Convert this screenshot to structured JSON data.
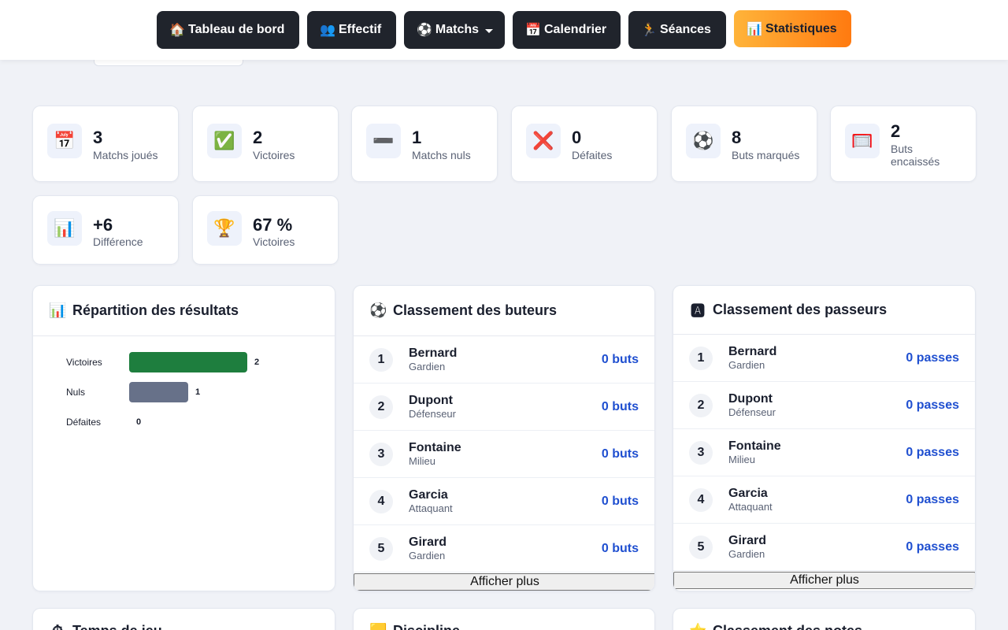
{
  "nav": {
    "items": [
      {
        "icon": "🏠",
        "label": "Tableau de bord"
      },
      {
        "icon": "👥",
        "label": "Effectif"
      },
      {
        "icon": "⚽",
        "label": "Matchs"
      },
      {
        "icon": "📅",
        "label": "Calendrier"
      },
      {
        "icon": "🏃",
        "label": "Séances"
      },
      {
        "icon": "📊",
        "label": "Statistiques"
      }
    ]
  },
  "stats": [
    {
      "icon": "📅",
      "value": "3",
      "label": "Matchs joués"
    },
    {
      "icon": "✅",
      "value": "2",
      "label": "Victoires"
    },
    {
      "icon": "➖",
      "value": "1",
      "label": "Matchs nuls"
    },
    {
      "icon": "❌",
      "value": "0",
      "label": "Défaites"
    },
    {
      "icon": "⚽",
      "value": "8",
      "label": "Buts marqués"
    },
    {
      "icon": "🥅",
      "value": "2",
      "label": "Buts encaissés"
    },
    {
      "icon": "📊",
      "value": "+6",
      "label": "Différence"
    },
    {
      "icon": "🏆",
      "value": "67 %",
      "label": "Victoires"
    }
  ],
  "results": {
    "icon": "📊",
    "title": "Répartition des résultats",
    "rows": [
      {
        "label": "Victoires",
        "value": 2,
        "color": "#1e7e3e"
      },
      {
        "label": "Nuls",
        "value": 1,
        "color": "#677189"
      },
      {
        "label": "Défaites",
        "value": 0,
        "color": "#c0392b"
      }
    ]
  },
  "scorers": {
    "icon": "⚽",
    "title": "Classement des buteurs",
    "rows": [
      {
        "rank": "1",
        "name": "Bernard",
        "position": "Gardien",
        "value": "0 buts"
      },
      {
        "rank": "2",
        "name": "Dupont",
        "position": "Défenseur",
        "value": "0 buts"
      },
      {
        "rank": "3",
        "name": "Fontaine",
        "position": "Milieu",
        "value": "0 buts"
      },
      {
        "rank": "4",
        "name": "Garcia",
        "position": "Attaquant",
        "value": "0 buts"
      },
      {
        "rank": "5",
        "name": "Girard",
        "position": "Gardien",
        "value": "0 buts"
      }
    ],
    "more_label": "Afficher plus"
  },
  "assists": {
    "icon": "🅰",
    "title": "Classement des passeurs",
    "rows": [
      {
        "rank": "1",
        "name": "Bernard",
        "position": "Gardien",
        "value": "0 passes"
      },
      {
        "rank": "2",
        "name": "Dupont",
        "position": "Défenseur",
        "value": "0 passes"
      },
      {
        "rank": "3",
        "name": "Fontaine",
        "position": "Milieu",
        "value": "0 passes"
      },
      {
        "rank": "4",
        "name": "Garcia",
        "position": "Attaquant",
        "value": "0 passes"
      },
      {
        "rank": "5",
        "name": "Girard",
        "position": "Gardien",
        "value": "0 passes"
      }
    ],
    "more_label": "Afficher plus"
  },
  "bottom_panels": [
    {
      "icon": "⏱",
      "title": "Temps de jeu"
    },
    {
      "icon": "🟨",
      "title": "Discipline"
    },
    {
      "icon": "⭐",
      "title": "Classement des notes"
    }
  ]
}
